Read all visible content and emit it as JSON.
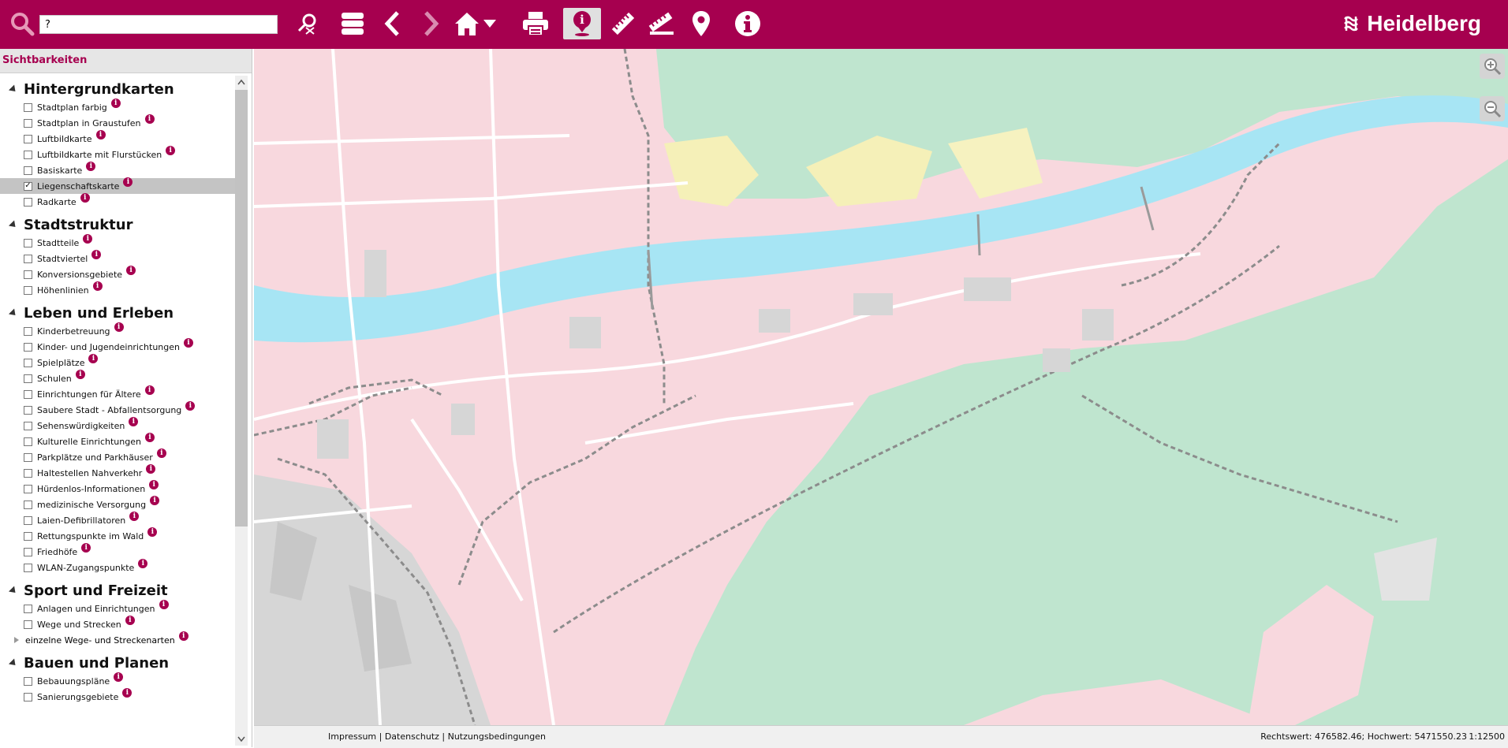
{
  "toolbar": {
    "search_value": "?",
    "buttons": [
      "search-icon",
      "clear-search-icon",
      "layers-icon",
      "back-icon",
      "forward-icon",
      "home-icon",
      "print-icon",
      "info-tool-icon",
      "measure-distance-icon",
      "measure-area-icon",
      "marker-icon",
      "about-icon"
    ],
    "brand": "Heidelberg",
    "accent": "#a6004f"
  },
  "sidebar": {
    "title": "Sichtbarkeiten",
    "groups": [
      {
        "title": "Hintergrundkarten",
        "items": [
          "Stadtplan farbig",
          "Stadtplan in Graustufen",
          "Luftbildkarte",
          "Luftbildkarte mit Flurstücken",
          "Basiskarte",
          "Liegenschaftskarte",
          "Radkarte"
        ]
      },
      {
        "title": "Stadtstruktur",
        "items": [
          "Stadtteile",
          "Stadtviertel",
          "Konversionsgebiete",
          "Höhenlinien"
        ]
      },
      {
        "title": "Leben und Erleben",
        "items": [
          "Kinderbetreuung",
          "Kinder- und Jugendeinrichtungen",
          "Spielplätze",
          "Schulen",
          "Einrichtungen für Ältere",
          "Saubere Stadt - Abfallentsorgung",
          "Sehenswürdigkeiten",
          "Kulturelle Einrichtungen",
          "Parkplätze und Parkhäuser",
          "Haltestellen Nahverkehr",
          "Hürdenlos-Informationen",
          "medizinische Versorgung",
          "Laien-Defibrillatoren",
          "Rettungspunkte im Wald",
          "Friedhöfe",
          "WLAN-Zugangspunkte"
        ]
      },
      {
        "title": "Sport und Freizeit",
        "items": [
          "Anlagen und Einrichtungen",
          "Wege und Strecken"
        ],
        "subgroup": "einzelne Wege- und Streckenarten"
      },
      {
        "title": "Bauen und Planen",
        "items": [
          "Bebauungspläne",
          "Sanierungsgebiete"
        ]
      }
    ],
    "checked": "Liegenschaftskarte",
    "info_glyph": "i",
    "check_glyph": "✓"
  },
  "footer": {
    "links": "Impressum | Datenschutz | Nutzungsbedingungen",
    "coords": "Rechtswert: 476582.46; Hochwert: 5471550.23",
    "scale": "1:12500"
  }
}
